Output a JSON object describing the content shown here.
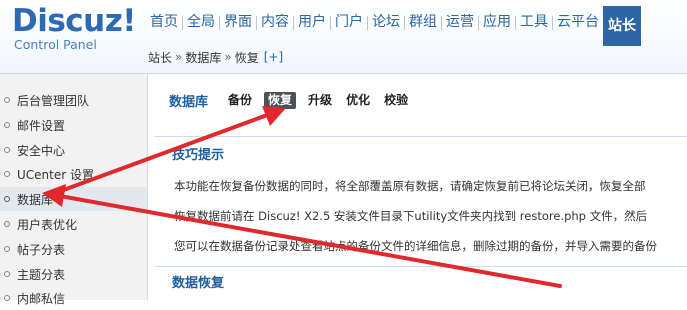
{
  "brand": {
    "title": "Discuz!",
    "subtitle": "Control Panel"
  },
  "nav": {
    "items": [
      "首页",
      "全局",
      "界面",
      "内容",
      "用户",
      "门户",
      "论坛",
      "群组",
      "运营",
      "应用",
      "工具",
      "云平台"
    ],
    "active": "站长"
  },
  "breadcrumb": {
    "items": [
      "站长",
      "数据库",
      "恢复"
    ],
    "separator": "»",
    "add_label": "[+]"
  },
  "sidebar": {
    "items": [
      "后台管理团队",
      "邮件设置",
      "安全中心",
      "UCenter 设置",
      "数据库",
      "用户表优化",
      "帖子分表",
      "主题分表",
      "内邮私信"
    ],
    "active_index": 4
  },
  "main": {
    "tabs_title": "数据库",
    "tabs": [
      "备份",
      "恢复",
      "升级",
      "优化",
      "校验"
    ],
    "active_tab_index": 1,
    "tips_title": "技巧提示",
    "tips": [
      "本功能在恢复备份数据的同时，将全部覆盖原有数据，请确定恢复前已将论坛关闭，恢复全部",
      "恢复数据前请在 Discuz! X2.5 安装文件目录下utility文件夹内找到 restore.php 文件，然后",
      "您可以在数据备份记录处查看站点的备份文件的详细信息，删除过期的备份，并导入需要的备份"
    ],
    "restore_title": "数据恢复"
  },
  "colors": {
    "brand": "#2e6ab1",
    "nav_active_bg": "#2c66a4",
    "annotation": "#e0282d"
  }
}
